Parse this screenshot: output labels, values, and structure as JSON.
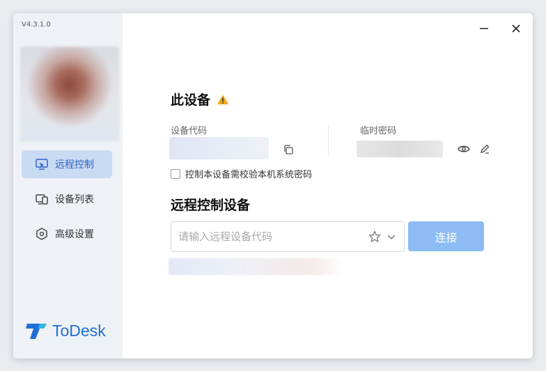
{
  "app": {
    "version": "V4.3.1.0",
    "logo_text": "ToDesk",
    "accent_color": "#2e63c7"
  },
  "sidebar": {
    "items": [
      {
        "label": "远程控制",
        "icon": "remote-control-icon",
        "active": true
      },
      {
        "label": "设备列表",
        "icon": "device-list-icon",
        "active": false
      },
      {
        "label": "高级设置",
        "icon": "settings-icon",
        "active": false
      }
    ]
  },
  "window_controls": {
    "minimize_icon": "minimize-icon",
    "close_icon": "close-icon"
  },
  "this_device": {
    "title": "此设备",
    "warning_icon": "warning-icon",
    "device_code_label": "设备代码",
    "temp_password_label": "临时密码",
    "checkbox_label": "控制本设备需校验本机系统密码",
    "checkbox_checked": false
  },
  "remote": {
    "title": "远程控制设备",
    "input_placeholder": "请输入远程设备代码",
    "input_value": "",
    "connect_label": "连接"
  }
}
